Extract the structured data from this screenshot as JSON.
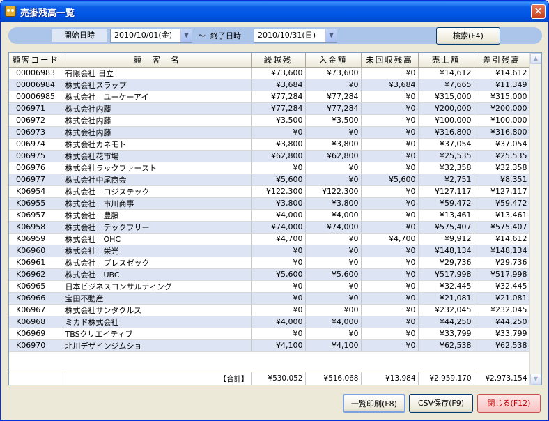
{
  "window": {
    "title": "売掛残高一覧",
    "close_glyph": "✕"
  },
  "search": {
    "start_label": "開始日時",
    "start_value": "2010/10/01(金)",
    "tilde": "〜",
    "end_label": "終了日時",
    "end_value": "2010/10/31(日)",
    "search_button": "検索(F4)"
  },
  "table": {
    "headers": [
      "顧客コード",
      "顧　客　名",
      "繰越残",
      "入金額",
      "未回収残高",
      "売上額",
      "差引残高"
    ],
    "rows": [
      [
        "00006983",
        "有限会社 日立",
        "¥73,600",
        "¥73,600",
        "¥0",
        "¥14,612",
        "¥14,612"
      ],
      [
        "00006984",
        "株式会社スラップ",
        "¥3,684",
        "¥0",
        "¥3,684",
        "¥7,665",
        "¥11,349"
      ],
      [
        "00006985",
        "株式会社　ユーケーアイ",
        "¥77,284",
        "¥77,284",
        "¥0",
        "¥315,000",
        "¥315,000"
      ],
      [
        "006971",
        "株式会社内藤",
        "¥77,284",
        "¥77,284",
        "¥0",
        "¥200,000",
        "¥200,000"
      ],
      [
        "006972",
        "株式会社内藤",
        "¥3,500",
        "¥3,500",
        "¥0",
        "¥100,000",
        "¥100,000"
      ],
      [
        "006973",
        "株式会社内藤",
        "¥0",
        "¥0",
        "¥0",
        "¥316,800",
        "¥316,800"
      ],
      [
        "006974",
        "株式会社カネモト",
        "¥3,800",
        "¥3,800",
        "¥0",
        "¥37,054",
        "¥37,054"
      ],
      [
        "006975",
        "株式会社花市場",
        "¥62,800",
        "¥62,800",
        "¥0",
        "¥25,535",
        "¥25,535"
      ],
      [
        "006976",
        "株式会社ラックファースト",
        "¥0",
        "¥0",
        "¥0",
        "¥32,358",
        "¥32,358"
      ],
      [
        "006977",
        "株式会社中尾商会",
        "¥5,600",
        "¥0",
        "¥5,600",
        "¥2,751",
        "¥8,351"
      ],
      [
        "K06954",
        "株式会社　ロジステック",
        "¥122,300",
        "¥122,300",
        "¥0",
        "¥127,117",
        "¥127,117"
      ],
      [
        "K06955",
        "株式会社　市川商事",
        "¥3,800",
        "¥3,800",
        "¥0",
        "¥59,472",
        "¥59,472"
      ],
      [
        "K06957",
        "株式会社　豊藤",
        "¥4,000",
        "¥4,000",
        "¥0",
        "¥13,461",
        "¥13,461"
      ],
      [
        "K06958",
        "株式会社　テックフリー",
        "¥74,000",
        "¥74,000",
        "¥0",
        "¥575,407",
        "¥575,407"
      ],
      [
        "K06959",
        "株式会社　OHC",
        "¥4,700",
        "¥0",
        "¥4,700",
        "¥9,912",
        "¥14,612"
      ],
      [
        "K06960",
        "株式会社　栄光",
        "¥0",
        "¥0",
        "¥0",
        "¥148,134",
        "¥148,134"
      ],
      [
        "K06961",
        "株式会社　ブレスゼック",
        "¥0",
        "¥0",
        "¥0",
        "¥29,736",
        "¥29,736"
      ],
      [
        "K06962",
        "株式会社　UBC",
        "¥5,600",
        "¥5,600",
        "¥0",
        "¥517,998",
        "¥517,998"
      ],
      [
        "K06965",
        "日本ビジネスコンサルティング",
        "¥0",
        "¥0",
        "¥0",
        "¥32,445",
        "¥32,445"
      ],
      [
        "K06966",
        "宝田不動産",
        "¥0",
        "¥0",
        "¥0",
        "¥21,081",
        "¥21,081"
      ],
      [
        "K06967",
        "株式会社サンタクルス",
        "¥0",
        "¥00",
        "¥0",
        "¥232,045",
        "¥232,045"
      ],
      [
        "K06968",
        "ミカド株式会社",
        "¥4,000",
        "¥4,000",
        "¥0",
        "¥44,250",
        "¥44,250"
      ],
      [
        "K06969",
        "TBSクリエイティブ",
        "¥0",
        "¥0",
        "¥0",
        "¥33,799",
        "¥33,799"
      ],
      [
        "K06970",
        "北川デザインジムショ",
        "¥4,100",
        "¥4,100",
        "¥0",
        "¥62,538",
        "¥62,538"
      ]
    ],
    "total_label": "【合計】",
    "totals": [
      "¥530,052",
      "¥516,068",
      "¥13,984",
      "¥2,959,170",
      "¥2,973,154"
    ]
  },
  "footer": {
    "print_button": "一覧印刷(F8)",
    "csv_button": "CSV保存(F9)",
    "close_button": "閉じる(F12)"
  }
}
